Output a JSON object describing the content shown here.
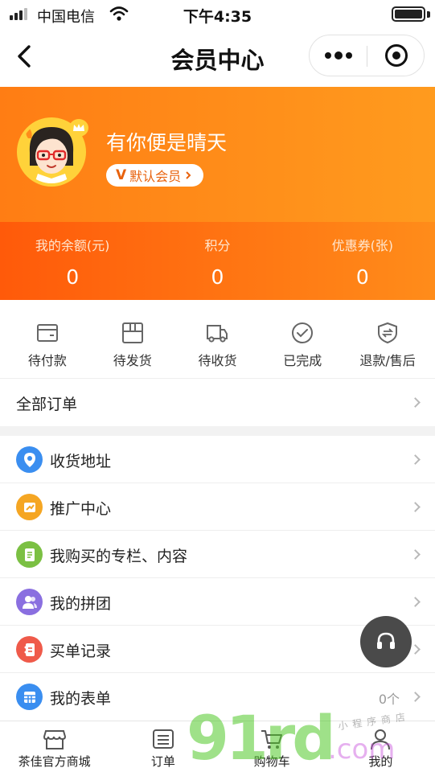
{
  "status_bar": {
    "carrier": "中国电信",
    "time": "下午4:35"
  },
  "nav": {
    "title": "会员中心"
  },
  "profile": {
    "username": "有你便是晴天",
    "level_prefix": "V",
    "level": "默认会员"
  },
  "stats": [
    {
      "label": "我的余额(元)",
      "value": "0"
    },
    {
      "label": "积分",
      "value": "0"
    },
    {
      "label": "优惠券(张)",
      "value": "0"
    }
  ],
  "order_shortcuts": [
    {
      "label": "待付款",
      "icon": "wallet-icon"
    },
    {
      "label": "待发货",
      "icon": "package-icon"
    },
    {
      "label": "待收货",
      "icon": "truck-icon"
    },
    {
      "label": "已完成",
      "icon": "check-circle-icon"
    },
    {
      "label": "退款/售后",
      "icon": "refund-shield-icon"
    }
  ],
  "all_orders": {
    "label": "全部订单"
  },
  "menu": [
    {
      "label": "收货地址",
      "icon": "location-pin-icon",
      "color": "#3a8ef0"
    },
    {
      "label": "推广中心",
      "icon": "share-icon",
      "color": "#f5a623"
    },
    {
      "label": "我购买的专栏、内容",
      "icon": "document-icon",
      "color": "#7bc043"
    },
    {
      "label": "我的拼团",
      "icon": "group-icon",
      "color": "#8a6fe0"
    },
    {
      "label": "买单记录",
      "icon": "receipt-icon",
      "color": "#ef5a4a"
    },
    {
      "label": "我的表单",
      "icon": "form-grid-icon",
      "color": "#3a8ef0",
      "count": "0个"
    }
  ],
  "tabs": [
    {
      "label": "茶佳官方商城",
      "icon": "store-icon"
    },
    {
      "label": "订单",
      "icon": "order-list-icon"
    },
    {
      "label": "购物车",
      "icon": "cart-icon"
    },
    {
      "label": "我的",
      "icon": "user-icon"
    }
  ],
  "watermark": {
    "text": "91rd",
    "suffix": ".com",
    "caption": "小程序商店"
  }
}
